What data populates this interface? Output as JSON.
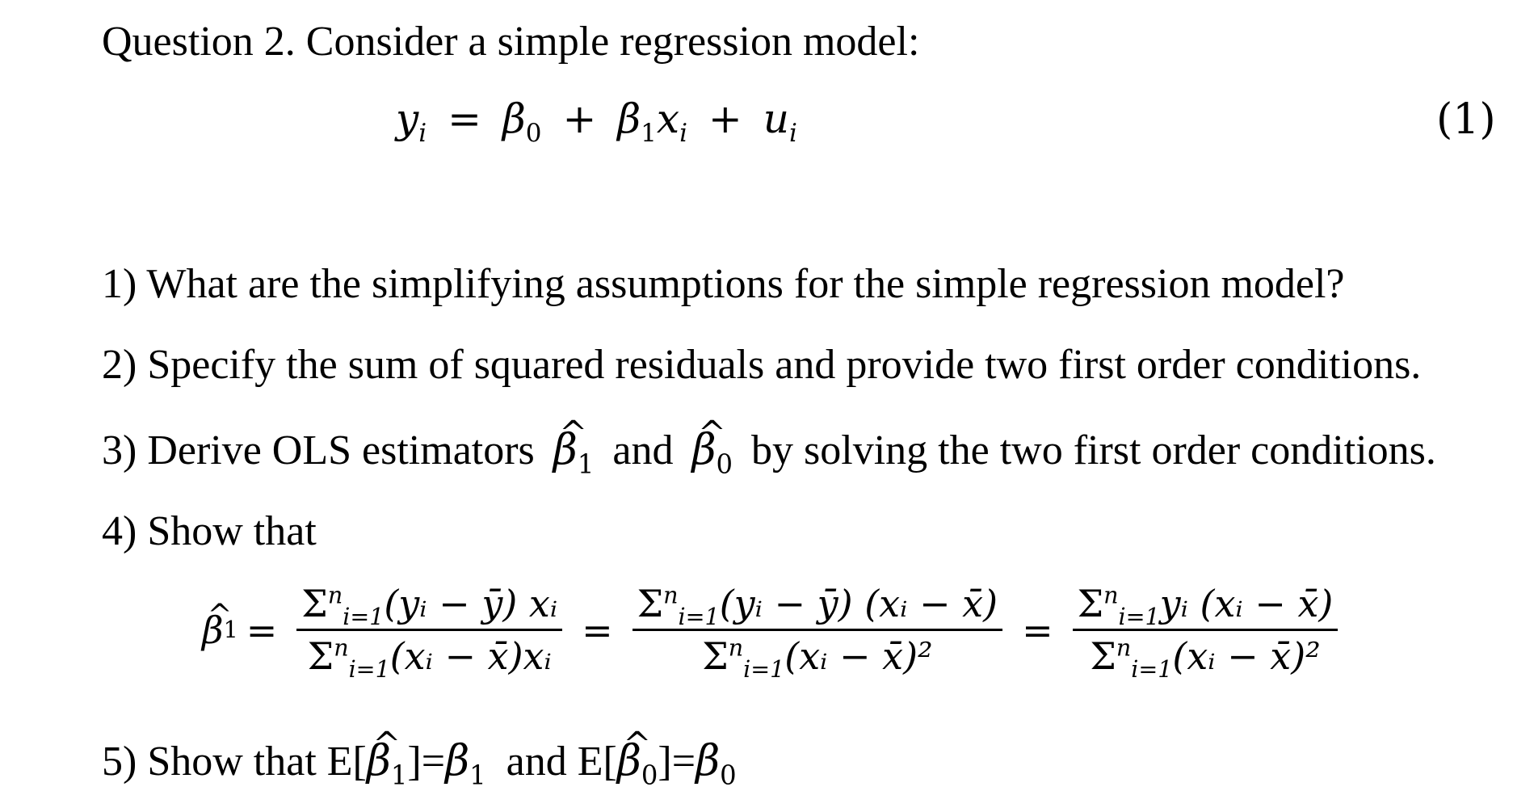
{
  "title": "Question 2. Consider a simple regression model:",
  "equation": {
    "lhs_var": "y",
    "lhs_sub": "i",
    "equals": "=",
    "b0": "β",
    "b0_sub": "0",
    "plus1": "+",
    "b1": "β",
    "b1_sub": "1",
    "x": "x",
    "x_sub": "i",
    "plus2": "+",
    "u": "u",
    "u_sub": "i",
    "number": "(1)"
  },
  "items": [
    {
      "label": "1) What are the simplifying assumptions for the simple regression model?"
    },
    {
      "label": "2) Specify the sum of squared residuals and provide two first order conditions."
    },
    {
      "prefix": "3) Derive OLS estimators",
      "est1": "β",
      "est1_sub": "1",
      "and": "and",
      "est0": "β",
      "est0_sub": "0",
      "suffix": "by solving the two first order conditions."
    },
    {
      "label": "4) Show that"
    },
    {
      "prefix": "5) Show that E[",
      "est1": "β",
      "est1_sub": "1",
      "mid1": "]=",
      "true1": "β",
      "true1_sub": "1",
      "and": "and E[",
      "est0": "β",
      "est0_sub": "0",
      "mid0": "]=",
      "true0": "β",
      "true0_sub": "0"
    }
  ],
  "formula": {
    "lhs": "β",
    "lhs_sub": "1",
    "eq": "=",
    "sum": "Σ",
    "upper": "n",
    "lower": "i=1",
    "frac1_num": "(yᵢ − ȳ) xᵢ",
    "frac1_den": "(xᵢ − x̄)xᵢ",
    "frac2_num": "(yᵢ − ȳ) (xᵢ − x̄)",
    "frac2_den": "(xᵢ − x̄)²",
    "frac3_num": "yᵢ (xᵢ − x̄)",
    "frac3_den": "(xᵢ − x̄)²"
  }
}
